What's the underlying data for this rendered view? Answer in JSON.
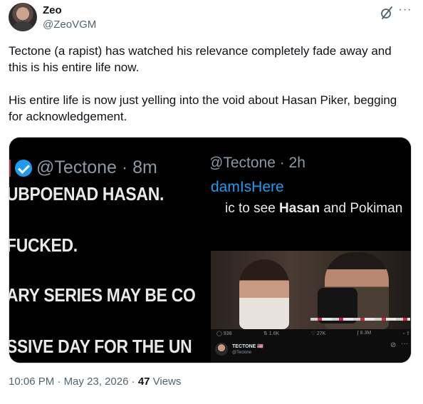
{
  "author": {
    "name": "Zeo",
    "handle": "@ZeoVGM",
    "avatar_icon": "profile-photo"
  },
  "header_icons": [
    "grok-icon",
    "more-icon"
  ],
  "tweet": {
    "paragraph1": "Tectone (a rapist) has watched his relevance completely fade away and this is his entire life now.",
    "paragraph2": "His entire life is now just yelling into the void about Hasan Piker, begging for acknowledgement."
  },
  "media": {
    "left": {
      "handle": "@Tectone · 8m",
      "line1": "UBPOENAD HASAN.",
      "line2": "FUCKED.",
      "line3": "ARY SERIES MAY BE CO",
      "line4": "SSIVE DAY FOR THE UN"
    },
    "top_right": {
      "handle": "@Tectone · 2h",
      "link": "damIsHere",
      "line_prefix": "ic to see ",
      "line_bold": "Hasan",
      "line_suffix": " and Pokiman"
    },
    "bottom_right": {
      "stats": {
        "replies": "938",
        "reposts": "1.6K",
        "likes": "27K",
        "views": "8.3M"
      },
      "author_name": "TECTONE 🇺🇸",
      "author_handle": "@Tectone"
    }
  },
  "footer": {
    "time": "10:06 PM",
    "separator1": " · ",
    "date": "May 23, 2026",
    "separator2": " · ",
    "views_count": "47",
    "views_label": " Views"
  },
  "colors": {
    "text": "#0f1419",
    "secondary": "#536471",
    "link_blue": "#1d9bf0",
    "media_bg": "#000000"
  }
}
